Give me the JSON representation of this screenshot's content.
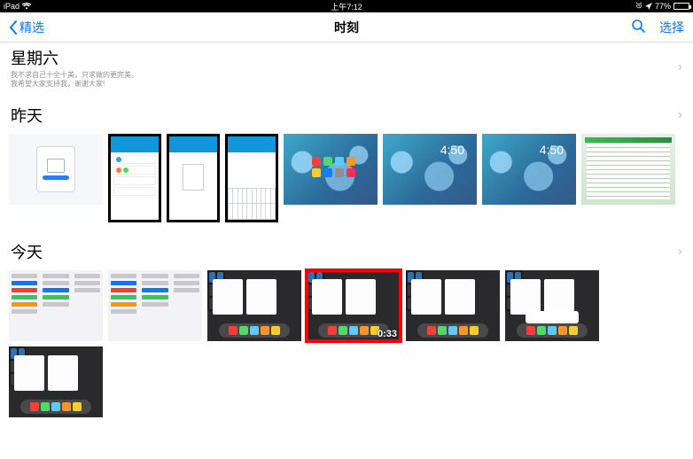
{
  "status": {
    "device": "iPad",
    "time": "上午7:12",
    "battery_pct": "77%"
  },
  "nav": {
    "back_label": "精选",
    "title": "时刻",
    "select_label": "选择"
  },
  "sections": {
    "sat": {
      "title": "星期六",
      "subtitle": "我不求自己十全十美，只求做的更完美。\n我希望大家支持我，谢谢大家!"
    },
    "yesterday": {
      "title": "昨天"
    },
    "today": {
      "title": "今天"
    }
  },
  "thumbs": {
    "lock_time": "4:50",
    "video_duration": "0:33"
  }
}
